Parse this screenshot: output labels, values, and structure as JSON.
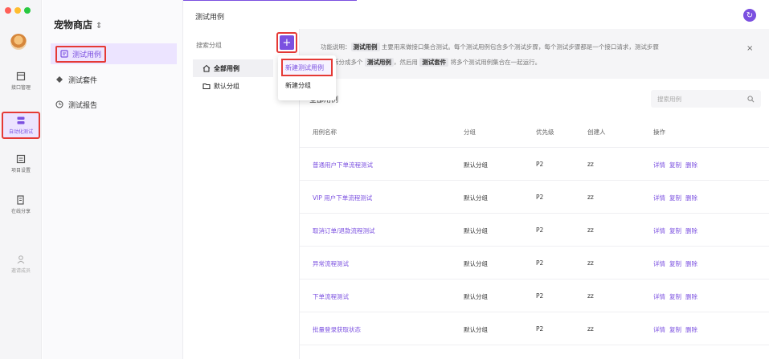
{
  "project": {
    "name": "宠物商店",
    "chevron": "⌃⌄"
  },
  "rail": {
    "items": [
      {
        "label": "接口管理",
        "icon": "api-icon"
      },
      {
        "label": "自动化测试",
        "icon": "automation-icon"
      },
      {
        "label": "项目设置",
        "icon": "settings-icon"
      },
      {
        "label": "在线分享",
        "icon": "share-icon"
      },
      {
        "label": "邀请成员",
        "icon": "invite-icon"
      }
    ]
  },
  "sidebar": {
    "items": [
      {
        "label": "测试用例",
        "icon": "document-icon"
      },
      {
        "label": "测试套件",
        "icon": "suite-icon"
      },
      {
        "label": "测试报告",
        "icon": "report-icon"
      }
    ]
  },
  "header": {
    "title": "测试用例",
    "action_icon": "refresh-icon"
  },
  "groups": {
    "search_placeholder": "搜索分组",
    "add_label": "+",
    "items": [
      {
        "label": "全部用例",
        "icon": "home-icon"
      },
      {
        "label": "默认分组",
        "icon": "folder-icon"
      }
    ]
  },
  "menu": {
    "items": [
      "新建测试用例",
      "新建分组"
    ]
  },
  "banner": {
    "prefix": "功能说明：",
    "tag1": "测试用例",
    "text1": " 主要用来做接口集合测试。每个测试用例包含多个测试步骤，每个测试步骤都是一个接口请求，测试步骤",
    "text2": "建议拆分成多个 ",
    "tag2": "测试用例",
    "text3": "，然后用 ",
    "tag3": "测试套件",
    "text4": " 将多个测试用例集合在一起运行。",
    "close": "×"
  },
  "cases": {
    "title": "全部用例",
    "search_placeholder": "搜索用例",
    "columns": [
      "用例名称",
      "分组",
      "优先级",
      "创建人",
      "操作"
    ],
    "rows": [
      {
        "name": "普通用户下单流程测试",
        "group": "默认分组",
        "priority": "P2",
        "creator": "zz"
      },
      {
        "name": "VIP 用户下单流程测试",
        "group": "默认分组",
        "priority": "P2",
        "creator": "zz"
      },
      {
        "name": "取消订单/退款流程测试",
        "group": "默认分组",
        "priority": "P2",
        "creator": "zz"
      },
      {
        "name": "异常流程测试",
        "group": "默认分组",
        "priority": "P2",
        "creator": "zz"
      },
      {
        "name": "下单流程测试",
        "group": "默认分组",
        "priority": "P2",
        "creator": "zz"
      },
      {
        "name": "批量登录获取状态",
        "group": "默认分组",
        "priority": "P2",
        "creator": "zz"
      }
    ],
    "ops": [
      "详情",
      "复制",
      "删除"
    ]
  },
  "colors": {
    "accent": "#7b50e0",
    "highlight": "#e53935"
  }
}
